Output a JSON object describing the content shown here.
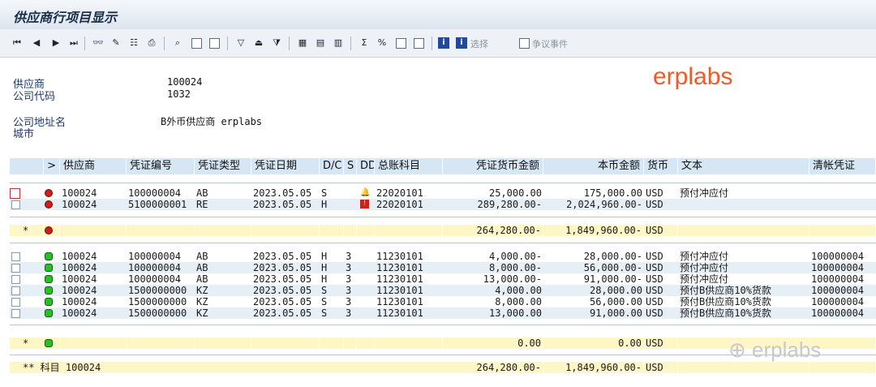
{
  "window": {
    "title": "供应商行项目显示"
  },
  "toolbar": {
    "select_label": "选择",
    "dispute_label": "争议事件"
  },
  "header_fields": {
    "vendor_label": "供应商",
    "vendor_value": "100024",
    "company_code_label": "公司代码",
    "company_code_value": "1032",
    "address_label": "公司地址名",
    "address_value": "B外币供应商 erplabs",
    "city_label": "城市"
  },
  "watermark": {
    "brand": "erplabs",
    "wechat_brand": "erplabs"
  },
  "table": {
    "columns": [
      "",
      ">",
      "供应商",
      "凭证编号",
      "凭证类型",
      "凭证日期",
      "D/C",
      "S",
      "DD",
      "总账科目",
      "凭证货币金额",
      "本币金额",
      "货币",
      "文本",
      "清帐凭证"
    ],
    "open_rows": [
      {
        "vendor": "100024",
        "doc": "100000004",
        "type": "AB",
        "date": "2023.05.05",
        "dc": "S",
        "s": "",
        "dd": "bell",
        "gl": "22020101",
        "amt": "25,000.00",
        "local": "175,000.00",
        "cur": "USD",
        "text": "预付冲应付",
        "clr": ""
      },
      {
        "vendor": "100024",
        "doc": "5100000001",
        "type": "RE",
        "date": "2023.05.05",
        "dc": "H",
        "s": "",
        "dd": "flag",
        "gl": "22020101",
        "amt": "289,280.00-",
        "local": "2,024,960.00-",
        "cur": "USD",
        "text": "",
        "clr": ""
      }
    ],
    "open_subtotal": {
      "marker": "*",
      "amt": "264,280.00-",
      "local": "1,849,960.00-",
      "cur": "USD"
    },
    "cleared_rows": [
      {
        "vendor": "100024",
        "doc": "100000004",
        "type": "AB",
        "date": "2023.05.05",
        "dc": "H",
        "s": "3",
        "gl": "11230101",
        "amt": "4,000.00-",
        "local": "28,000.00-",
        "cur": "USD",
        "text": "预付冲应付",
        "clr": "100000004"
      },
      {
        "vendor": "100024",
        "doc": "100000004",
        "type": "AB",
        "date": "2023.05.05",
        "dc": "H",
        "s": "3",
        "gl": "11230101",
        "amt": "8,000.00-",
        "local": "56,000.00-",
        "cur": "USD",
        "text": "预付冲应付",
        "clr": "100000004"
      },
      {
        "vendor": "100024",
        "doc": "100000004",
        "type": "AB",
        "date": "2023.05.05",
        "dc": "H",
        "s": "3",
        "gl": "11230101",
        "amt": "13,000.00-",
        "local": "91,000.00-",
        "cur": "USD",
        "text": "预付冲应付",
        "clr": "100000004"
      },
      {
        "vendor": "100024",
        "doc": "1500000000",
        "type": "KZ",
        "date": "2023.05.05",
        "dc": "S",
        "s": "3",
        "gl": "11230101",
        "amt": "4,000.00",
        "local": "28,000.00",
        "cur": "USD",
        "text": "预付B供应商10%货款",
        "clr": "100000004"
      },
      {
        "vendor": "100024",
        "doc": "1500000000",
        "type": "KZ",
        "date": "2023.05.05",
        "dc": "S",
        "s": "3",
        "gl": "11230101",
        "amt": "8,000.00",
        "local": "56,000.00",
        "cur": "USD",
        "text": "预付B供应商10%货款",
        "clr": "100000004"
      },
      {
        "vendor": "100024",
        "doc": "1500000000",
        "type": "KZ",
        "date": "2023.05.05",
        "dc": "S",
        "s": "3",
        "gl": "11230101",
        "amt": "13,000.00",
        "local": "91,000.00",
        "cur": "USD",
        "text": "预付B供应商10%货款",
        "clr": "100000004"
      }
    ],
    "cleared_subtotal": {
      "marker": "*",
      "amt": "0.00",
      "local": "0.00",
      "cur": "USD"
    },
    "account_total": {
      "label": "** 科目 100024",
      "amt": "264,280.00-",
      "local": "1,849,960.00-",
      "cur": "USD"
    }
  }
}
